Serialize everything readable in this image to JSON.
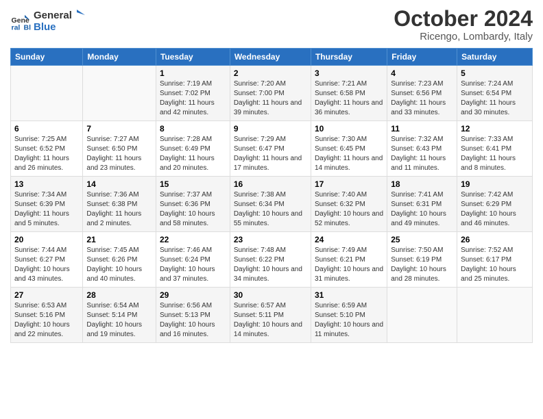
{
  "logo": {
    "line1": "General",
    "line2": "Blue"
  },
  "title": "October 2024",
  "subtitle": "Ricengo, Lombardy, Italy",
  "days_of_week": [
    "Sunday",
    "Monday",
    "Tuesday",
    "Wednesday",
    "Thursday",
    "Friday",
    "Saturday"
  ],
  "weeks": [
    [
      {
        "day": "",
        "sunrise": "",
        "sunset": "",
        "daylight": ""
      },
      {
        "day": "",
        "sunrise": "",
        "sunset": "",
        "daylight": ""
      },
      {
        "day": "1",
        "sunrise": "Sunrise: 7:19 AM",
        "sunset": "Sunset: 7:02 PM",
        "daylight": "Daylight: 11 hours and 42 minutes."
      },
      {
        "day": "2",
        "sunrise": "Sunrise: 7:20 AM",
        "sunset": "Sunset: 7:00 PM",
        "daylight": "Daylight: 11 hours and 39 minutes."
      },
      {
        "day": "3",
        "sunrise": "Sunrise: 7:21 AM",
        "sunset": "Sunset: 6:58 PM",
        "daylight": "Daylight: 11 hours and 36 minutes."
      },
      {
        "day": "4",
        "sunrise": "Sunrise: 7:23 AM",
        "sunset": "Sunset: 6:56 PM",
        "daylight": "Daylight: 11 hours and 33 minutes."
      },
      {
        "day": "5",
        "sunrise": "Sunrise: 7:24 AM",
        "sunset": "Sunset: 6:54 PM",
        "daylight": "Daylight: 11 hours and 30 minutes."
      }
    ],
    [
      {
        "day": "6",
        "sunrise": "Sunrise: 7:25 AM",
        "sunset": "Sunset: 6:52 PM",
        "daylight": "Daylight: 11 hours and 26 minutes."
      },
      {
        "day": "7",
        "sunrise": "Sunrise: 7:27 AM",
        "sunset": "Sunset: 6:50 PM",
        "daylight": "Daylight: 11 hours and 23 minutes."
      },
      {
        "day": "8",
        "sunrise": "Sunrise: 7:28 AM",
        "sunset": "Sunset: 6:49 PM",
        "daylight": "Daylight: 11 hours and 20 minutes."
      },
      {
        "day": "9",
        "sunrise": "Sunrise: 7:29 AM",
        "sunset": "Sunset: 6:47 PM",
        "daylight": "Daylight: 11 hours and 17 minutes."
      },
      {
        "day": "10",
        "sunrise": "Sunrise: 7:30 AM",
        "sunset": "Sunset: 6:45 PM",
        "daylight": "Daylight: 11 hours and 14 minutes."
      },
      {
        "day": "11",
        "sunrise": "Sunrise: 7:32 AM",
        "sunset": "Sunset: 6:43 PM",
        "daylight": "Daylight: 11 hours and 11 minutes."
      },
      {
        "day": "12",
        "sunrise": "Sunrise: 7:33 AM",
        "sunset": "Sunset: 6:41 PM",
        "daylight": "Daylight: 11 hours and 8 minutes."
      }
    ],
    [
      {
        "day": "13",
        "sunrise": "Sunrise: 7:34 AM",
        "sunset": "Sunset: 6:39 PM",
        "daylight": "Daylight: 11 hours and 5 minutes."
      },
      {
        "day": "14",
        "sunrise": "Sunrise: 7:36 AM",
        "sunset": "Sunset: 6:38 PM",
        "daylight": "Daylight: 11 hours and 2 minutes."
      },
      {
        "day": "15",
        "sunrise": "Sunrise: 7:37 AM",
        "sunset": "Sunset: 6:36 PM",
        "daylight": "Daylight: 10 hours and 58 minutes."
      },
      {
        "day": "16",
        "sunrise": "Sunrise: 7:38 AM",
        "sunset": "Sunset: 6:34 PM",
        "daylight": "Daylight: 10 hours and 55 minutes."
      },
      {
        "day": "17",
        "sunrise": "Sunrise: 7:40 AM",
        "sunset": "Sunset: 6:32 PM",
        "daylight": "Daylight: 10 hours and 52 minutes."
      },
      {
        "day": "18",
        "sunrise": "Sunrise: 7:41 AM",
        "sunset": "Sunset: 6:31 PM",
        "daylight": "Daylight: 10 hours and 49 minutes."
      },
      {
        "day": "19",
        "sunrise": "Sunrise: 7:42 AM",
        "sunset": "Sunset: 6:29 PM",
        "daylight": "Daylight: 10 hours and 46 minutes."
      }
    ],
    [
      {
        "day": "20",
        "sunrise": "Sunrise: 7:44 AM",
        "sunset": "Sunset: 6:27 PM",
        "daylight": "Daylight: 10 hours and 43 minutes."
      },
      {
        "day": "21",
        "sunrise": "Sunrise: 7:45 AM",
        "sunset": "Sunset: 6:26 PM",
        "daylight": "Daylight: 10 hours and 40 minutes."
      },
      {
        "day": "22",
        "sunrise": "Sunrise: 7:46 AM",
        "sunset": "Sunset: 6:24 PM",
        "daylight": "Daylight: 10 hours and 37 minutes."
      },
      {
        "day": "23",
        "sunrise": "Sunrise: 7:48 AM",
        "sunset": "Sunset: 6:22 PM",
        "daylight": "Daylight: 10 hours and 34 minutes."
      },
      {
        "day": "24",
        "sunrise": "Sunrise: 7:49 AM",
        "sunset": "Sunset: 6:21 PM",
        "daylight": "Daylight: 10 hours and 31 minutes."
      },
      {
        "day": "25",
        "sunrise": "Sunrise: 7:50 AM",
        "sunset": "Sunset: 6:19 PM",
        "daylight": "Daylight: 10 hours and 28 minutes."
      },
      {
        "day": "26",
        "sunrise": "Sunrise: 7:52 AM",
        "sunset": "Sunset: 6:17 PM",
        "daylight": "Daylight: 10 hours and 25 minutes."
      }
    ],
    [
      {
        "day": "27",
        "sunrise": "Sunrise: 6:53 AM",
        "sunset": "Sunset: 5:16 PM",
        "daylight": "Daylight: 10 hours and 22 minutes."
      },
      {
        "day": "28",
        "sunrise": "Sunrise: 6:54 AM",
        "sunset": "Sunset: 5:14 PM",
        "daylight": "Daylight: 10 hours and 19 minutes."
      },
      {
        "day": "29",
        "sunrise": "Sunrise: 6:56 AM",
        "sunset": "Sunset: 5:13 PM",
        "daylight": "Daylight: 10 hours and 16 minutes."
      },
      {
        "day": "30",
        "sunrise": "Sunrise: 6:57 AM",
        "sunset": "Sunset: 5:11 PM",
        "daylight": "Daylight: 10 hours and 14 minutes."
      },
      {
        "day": "31",
        "sunrise": "Sunrise: 6:59 AM",
        "sunset": "Sunset: 5:10 PM",
        "daylight": "Daylight: 10 hours and 11 minutes."
      },
      {
        "day": "",
        "sunrise": "",
        "sunset": "",
        "daylight": ""
      },
      {
        "day": "",
        "sunrise": "",
        "sunset": "",
        "daylight": ""
      }
    ]
  ]
}
